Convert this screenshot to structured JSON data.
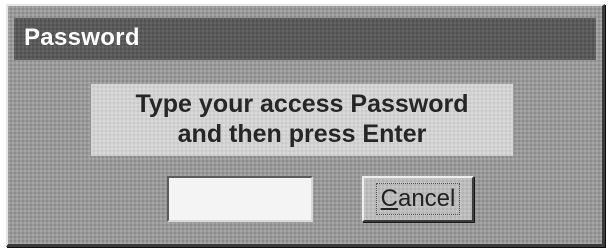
{
  "dialog": {
    "title": "Password",
    "prompt_line1": "Type your access Password",
    "prompt_line2": "and then press Enter",
    "password_value": "",
    "cancel_mnemonic": "C",
    "cancel_rest": "ancel",
    "cancel_label": "Cancel"
  },
  "colors": {
    "titlebar": "#5a5a5a",
    "dialog_bg": "#9a9a9a",
    "prompt_bg": "#d2d2d2",
    "title_text": "#ffffff"
  }
}
